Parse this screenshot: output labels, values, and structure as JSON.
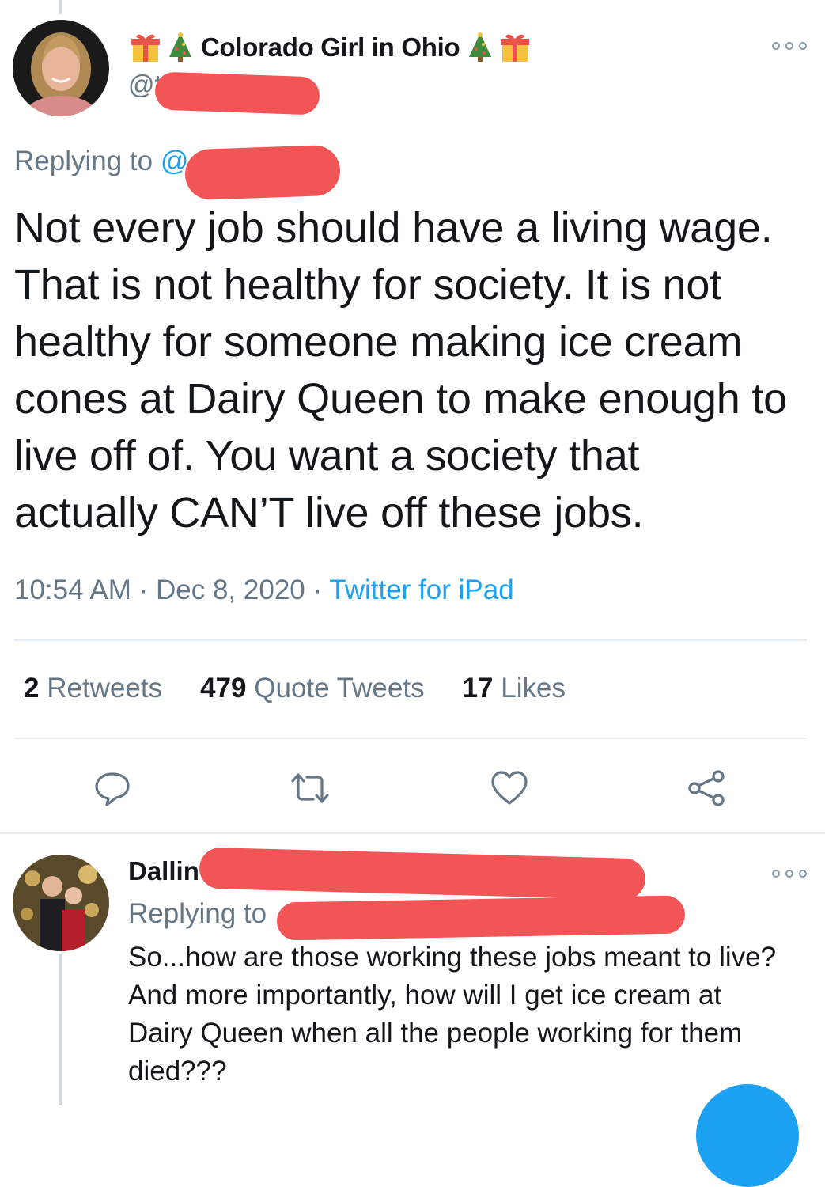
{
  "tweet": {
    "display_name": "Colorado Girl in Ohio",
    "name_emoji_left": [
      "🎁",
      "🎄"
    ],
    "name_emoji_right": [
      "🎄",
      "🎁"
    ],
    "handle_visible": "@t",
    "replying_label": "Replying to",
    "replying_handle_visible": "@e",
    "text_lines": [
      "Not every job should have a living wage.",
      "That is not healthy for society. It is not",
      "healthy for someone making ice cream",
      "cones at Dairy Queen to make enough to",
      "live off of.  You want a society that",
      "actually CAN’T live off these jobs."
    ],
    "time": "10:54 AM",
    "separator": "·",
    "date": "Dec 8, 2020",
    "source": "Twitter for iPad",
    "stats": {
      "retweets_count": "2",
      "retweets_label": "Retweets",
      "quotes_count": "479",
      "quotes_label": "Quote Tweets",
      "likes_count": "17",
      "likes_label": "Likes"
    }
  },
  "actions": [
    "reply-icon",
    "retweet-icon",
    "like-icon",
    "share-icon"
  ],
  "reply": {
    "display_name_visible": "Dallin",
    "replying_label": "Replying to",
    "text_lines": [
      "So...how are those working these jobs meant to live?",
      "And more importantly, how will I get ice cream at",
      "Dairy Queen when all the people working for them",
      "died???"
    ]
  },
  "colors": {
    "accent": "#1da1f2",
    "secondary_text": "#657786",
    "primary_text": "#14171a",
    "redaction": "#f25555",
    "divider": "#e6ecf0"
  }
}
